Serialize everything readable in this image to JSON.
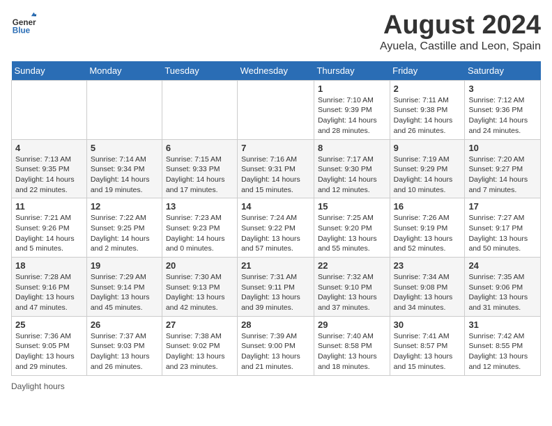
{
  "header": {
    "logo_general": "General",
    "logo_blue": "Blue",
    "title": "August 2024",
    "subtitle": "Ayuela, Castille and Leon, Spain"
  },
  "days_of_week": [
    "Sunday",
    "Monday",
    "Tuesday",
    "Wednesday",
    "Thursday",
    "Friday",
    "Saturday"
  ],
  "weeks": [
    [
      {
        "num": "",
        "info": ""
      },
      {
        "num": "",
        "info": ""
      },
      {
        "num": "",
        "info": ""
      },
      {
        "num": "",
        "info": ""
      },
      {
        "num": "1",
        "info": "Sunrise: 7:10 AM\nSunset: 9:39 PM\nDaylight: 14 hours\nand 28 minutes."
      },
      {
        "num": "2",
        "info": "Sunrise: 7:11 AM\nSunset: 9:38 PM\nDaylight: 14 hours\nand 26 minutes."
      },
      {
        "num": "3",
        "info": "Sunrise: 7:12 AM\nSunset: 9:36 PM\nDaylight: 14 hours\nand 24 minutes."
      }
    ],
    [
      {
        "num": "4",
        "info": "Sunrise: 7:13 AM\nSunset: 9:35 PM\nDaylight: 14 hours\nand 22 minutes."
      },
      {
        "num": "5",
        "info": "Sunrise: 7:14 AM\nSunset: 9:34 PM\nDaylight: 14 hours\nand 19 minutes."
      },
      {
        "num": "6",
        "info": "Sunrise: 7:15 AM\nSunset: 9:33 PM\nDaylight: 14 hours\nand 17 minutes."
      },
      {
        "num": "7",
        "info": "Sunrise: 7:16 AM\nSunset: 9:31 PM\nDaylight: 14 hours\nand 15 minutes."
      },
      {
        "num": "8",
        "info": "Sunrise: 7:17 AM\nSunset: 9:30 PM\nDaylight: 14 hours\nand 12 minutes."
      },
      {
        "num": "9",
        "info": "Sunrise: 7:19 AM\nSunset: 9:29 PM\nDaylight: 14 hours\nand 10 minutes."
      },
      {
        "num": "10",
        "info": "Sunrise: 7:20 AM\nSunset: 9:27 PM\nDaylight: 14 hours\nand 7 minutes."
      }
    ],
    [
      {
        "num": "11",
        "info": "Sunrise: 7:21 AM\nSunset: 9:26 PM\nDaylight: 14 hours\nand 5 minutes."
      },
      {
        "num": "12",
        "info": "Sunrise: 7:22 AM\nSunset: 9:25 PM\nDaylight: 14 hours\nand 2 minutes."
      },
      {
        "num": "13",
        "info": "Sunrise: 7:23 AM\nSunset: 9:23 PM\nDaylight: 14 hours\nand 0 minutes."
      },
      {
        "num": "14",
        "info": "Sunrise: 7:24 AM\nSunset: 9:22 PM\nDaylight: 13 hours\nand 57 minutes."
      },
      {
        "num": "15",
        "info": "Sunrise: 7:25 AM\nSunset: 9:20 PM\nDaylight: 13 hours\nand 55 minutes."
      },
      {
        "num": "16",
        "info": "Sunrise: 7:26 AM\nSunset: 9:19 PM\nDaylight: 13 hours\nand 52 minutes."
      },
      {
        "num": "17",
        "info": "Sunrise: 7:27 AM\nSunset: 9:17 PM\nDaylight: 13 hours\nand 50 minutes."
      }
    ],
    [
      {
        "num": "18",
        "info": "Sunrise: 7:28 AM\nSunset: 9:16 PM\nDaylight: 13 hours\nand 47 minutes."
      },
      {
        "num": "19",
        "info": "Sunrise: 7:29 AM\nSunset: 9:14 PM\nDaylight: 13 hours\nand 45 minutes."
      },
      {
        "num": "20",
        "info": "Sunrise: 7:30 AM\nSunset: 9:13 PM\nDaylight: 13 hours\nand 42 minutes."
      },
      {
        "num": "21",
        "info": "Sunrise: 7:31 AM\nSunset: 9:11 PM\nDaylight: 13 hours\nand 39 minutes."
      },
      {
        "num": "22",
        "info": "Sunrise: 7:32 AM\nSunset: 9:10 PM\nDaylight: 13 hours\nand 37 minutes."
      },
      {
        "num": "23",
        "info": "Sunrise: 7:34 AM\nSunset: 9:08 PM\nDaylight: 13 hours\nand 34 minutes."
      },
      {
        "num": "24",
        "info": "Sunrise: 7:35 AM\nSunset: 9:06 PM\nDaylight: 13 hours\nand 31 minutes."
      }
    ],
    [
      {
        "num": "25",
        "info": "Sunrise: 7:36 AM\nSunset: 9:05 PM\nDaylight: 13 hours\nand 29 minutes."
      },
      {
        "num": "26",
        "info": "Sunrise: 7:37 AM\nSunset: 9:03 PM\nDaylight: 13 hours\nand 26 minutes."
      },
      {
        "num": "27",
        "info": "Sunrise: 7:38 AM\nSunset: 9:02 PM\nDaylight: 13 hours\nand 23 minutes."
      },
      {
        "num": "28",
        "info": "Sunrise: 7:39 AM\nSunset: 9:00 PM\nDaylight: 13 hours\nand 21 minutes."
      },
      {
        "num": "29",
        "info": "Sunrise: 7:40 AM\nSunset: 8:58 PM\nDaylight: 13 hours\nand 18 minutes."
      },
      {
        "num": "30",
        "info": "Sunrise: 7:41 AM\nSunset: 8:57 PM\nDaylight: 13 hours\nand 15 minutes."
      },
      {
        "num": "31",
        "info": "Sunrise: 7:42 AM\nSunset: 8:55 PM\nDaylight: 13 hours\nand 12 minutes."
      }
    ]
  ],
  "footer": {
    "daylight_label": "Daylight hours"
  }
}
